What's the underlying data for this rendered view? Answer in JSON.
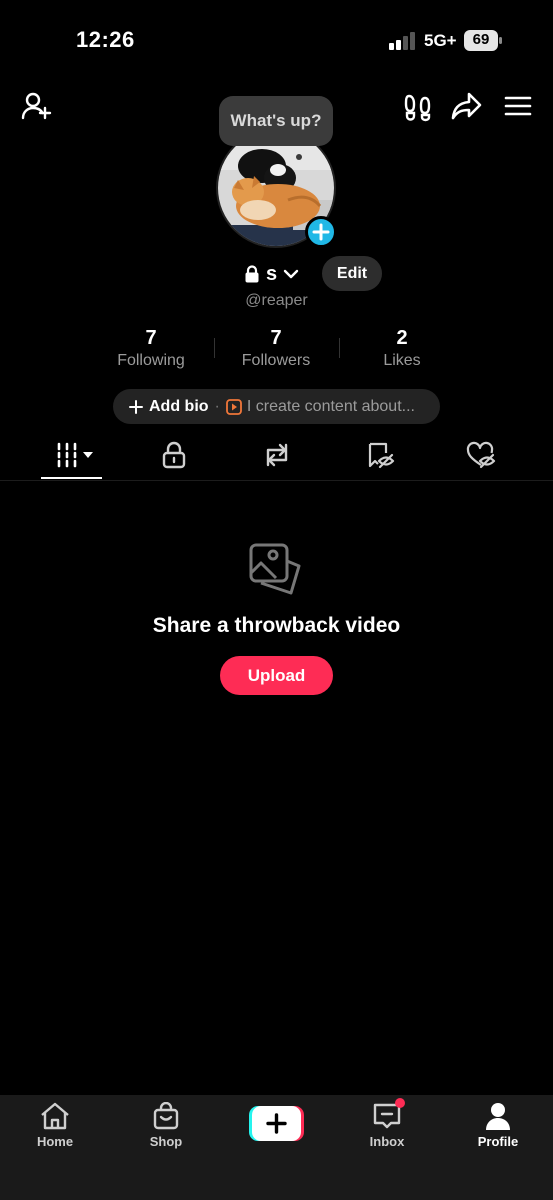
{
  "status_bar": {
    "time": "12:26",
    "network": "5G+",
    "battery": "69"
  },
  "tooltip": {
    "text": "What's up?"
  },
  "profile": {
    "name": "s",
    "edit_label": "Edit",
    "handle": "@reaper"
  },
  "stats": [
    {
      "value": "7",
      "label": "Following"
    },
    {
      "value": "7",
      "label": "Followers"
    },
    {
      "value": "2",
      "label": "Likes"
    }
  ],
  "bio": {
    "add_label": "Add bio",
    "separator": "·",
    "prompt": "I create content about..."
  },
  "tabs": [
    "videos-grid-icon",
    "lock-icon",
    "repost-icon",
    "saved-icon",
    "liked-icon"
  ],
  "empty_state": {
    "title": "Share a throwback video",
    "button": "Upload"
  },
  "bottom_nav": [
    {
      "label": "Home"
    },
    {
      "label": "Shop"
    },
    {
      "label": ""
    },
    {
      "label": "Inbox"
    },
    {
      "label": "Profile"
    }
  ],
  "colors": {
    "accent": "#fe2c55",
    "avatar_plus": "#20b8e6",
    "background": "#000000"
  }
}
